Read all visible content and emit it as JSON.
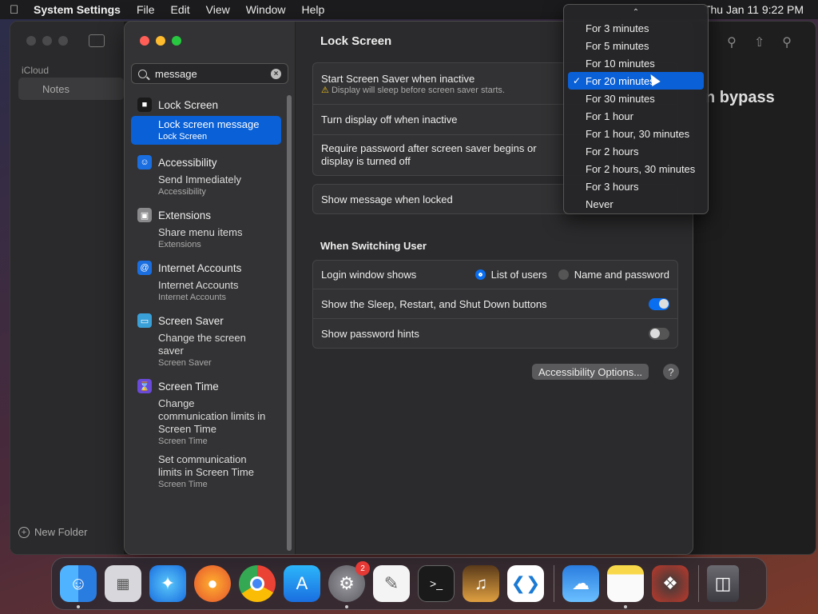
{
  "menubar": {
    "app": "System Settings",
    "items": [
      "File",
      "Edit",
      "View",
      "Window",
      "Help"
    ],
    "clock": "Thu Jan 11  9:22 PM"
  },
  "notes": {
    "section": "iCloud",
    "folder": "Notes",
    "new_folder": "New Folder",
    "content_fragment": "n bypass"
  },
  "settings": {
    "search_value": "message",
    "results": [
      {
        "category": "Lock Screen",
        "items": [
          {
            "title": "Lock screen message",
            "subtitle": "Lock Screen",
            "selected": true
          }
        ]
      },
      {
        "category": "Accessibility",
        "items": [
          {
            "title": "Send Immediately",
            "subtitle": "Accessibility"
          }
        ]
      },
      {
        "category": "Extensions",
        "items": [
          {
            "title": "Share menu items",
            "subtitle": "Extensions"
          }
        ]
      },
      {
        "category": "Internet Accounts",
        "items": [
          {
            "title": "Internet Accounts",
            "subtitle": "Internet Accounts"
          }
        ]
      },
      {
        "category": "Screen Saver",
        "items": [
          {
            "title": "Change the screen saver",
            "subtitle": "Screen Saver"
          }
        ]
      },
      {
        "category": "Screen Time",
        "items": [
          {
            "title": "Change communication limits in Screen Time",
            "subtitle": "Screen Time"
          },
          {
            "title": "Set communication limits in Screen Time",
            "subtitle": "Screen Time"
          }
        ]
      }
    ],
    "pane_title": "Lock Screen",
    "screen_saver_label": "Start Screen Saver when inactive",
    "screen_saver_warning": "Display will sleep before screen saver starts.",
    "display_off_label": "Turn display off when inactive",
    "require_password_label": "Require password after screen saver begins or display is turned off",
    "show_message_label": "Show message when locked",
    "switching_title": "When Switching User",
    "login_window_label": "Login window shows",
    "login_option_list": "List of users",
    "login_option_name": "Name and password",
    "sleep_buttons_label": "Show the Sleep, Restart, and Shut Down buttons",
    "password_hints_label": "Show password hints",
    "accessibility_button": "Accessibility Options...",
    "help_button": "?"
  },
  "dropdown": {
    "options": [
      "For 3 minutes",
      "For 5 minutes",
      "For 10 minutes",
      "For 20 minutes",
      "For 30 minutes",
      "For 1 hour",
      "For 1 hour, 30 minutes",
      "For 2 hours",
      "For 2 hours, 30 minutes",
      "For 3 hours",
      "Never"
    ],
    "selected": "For 20 minutes"
  },
  "dock": {
    "apps": [
      "Finder",
      "Launchpad",
      "Safari",
      "Firefox",
      "Chrome",
      "App Store",
      "System Settings",
      "TextEdit",
      "Terminal",
      "GarageBand",
      "VS Code",
      "Weather",
      "Notes",
      "Instruments",
      "Trash"
    ],
    "settings_badge": "2"
  },
  "colors": {
    "accent": "#0a60d6"
  }
}
